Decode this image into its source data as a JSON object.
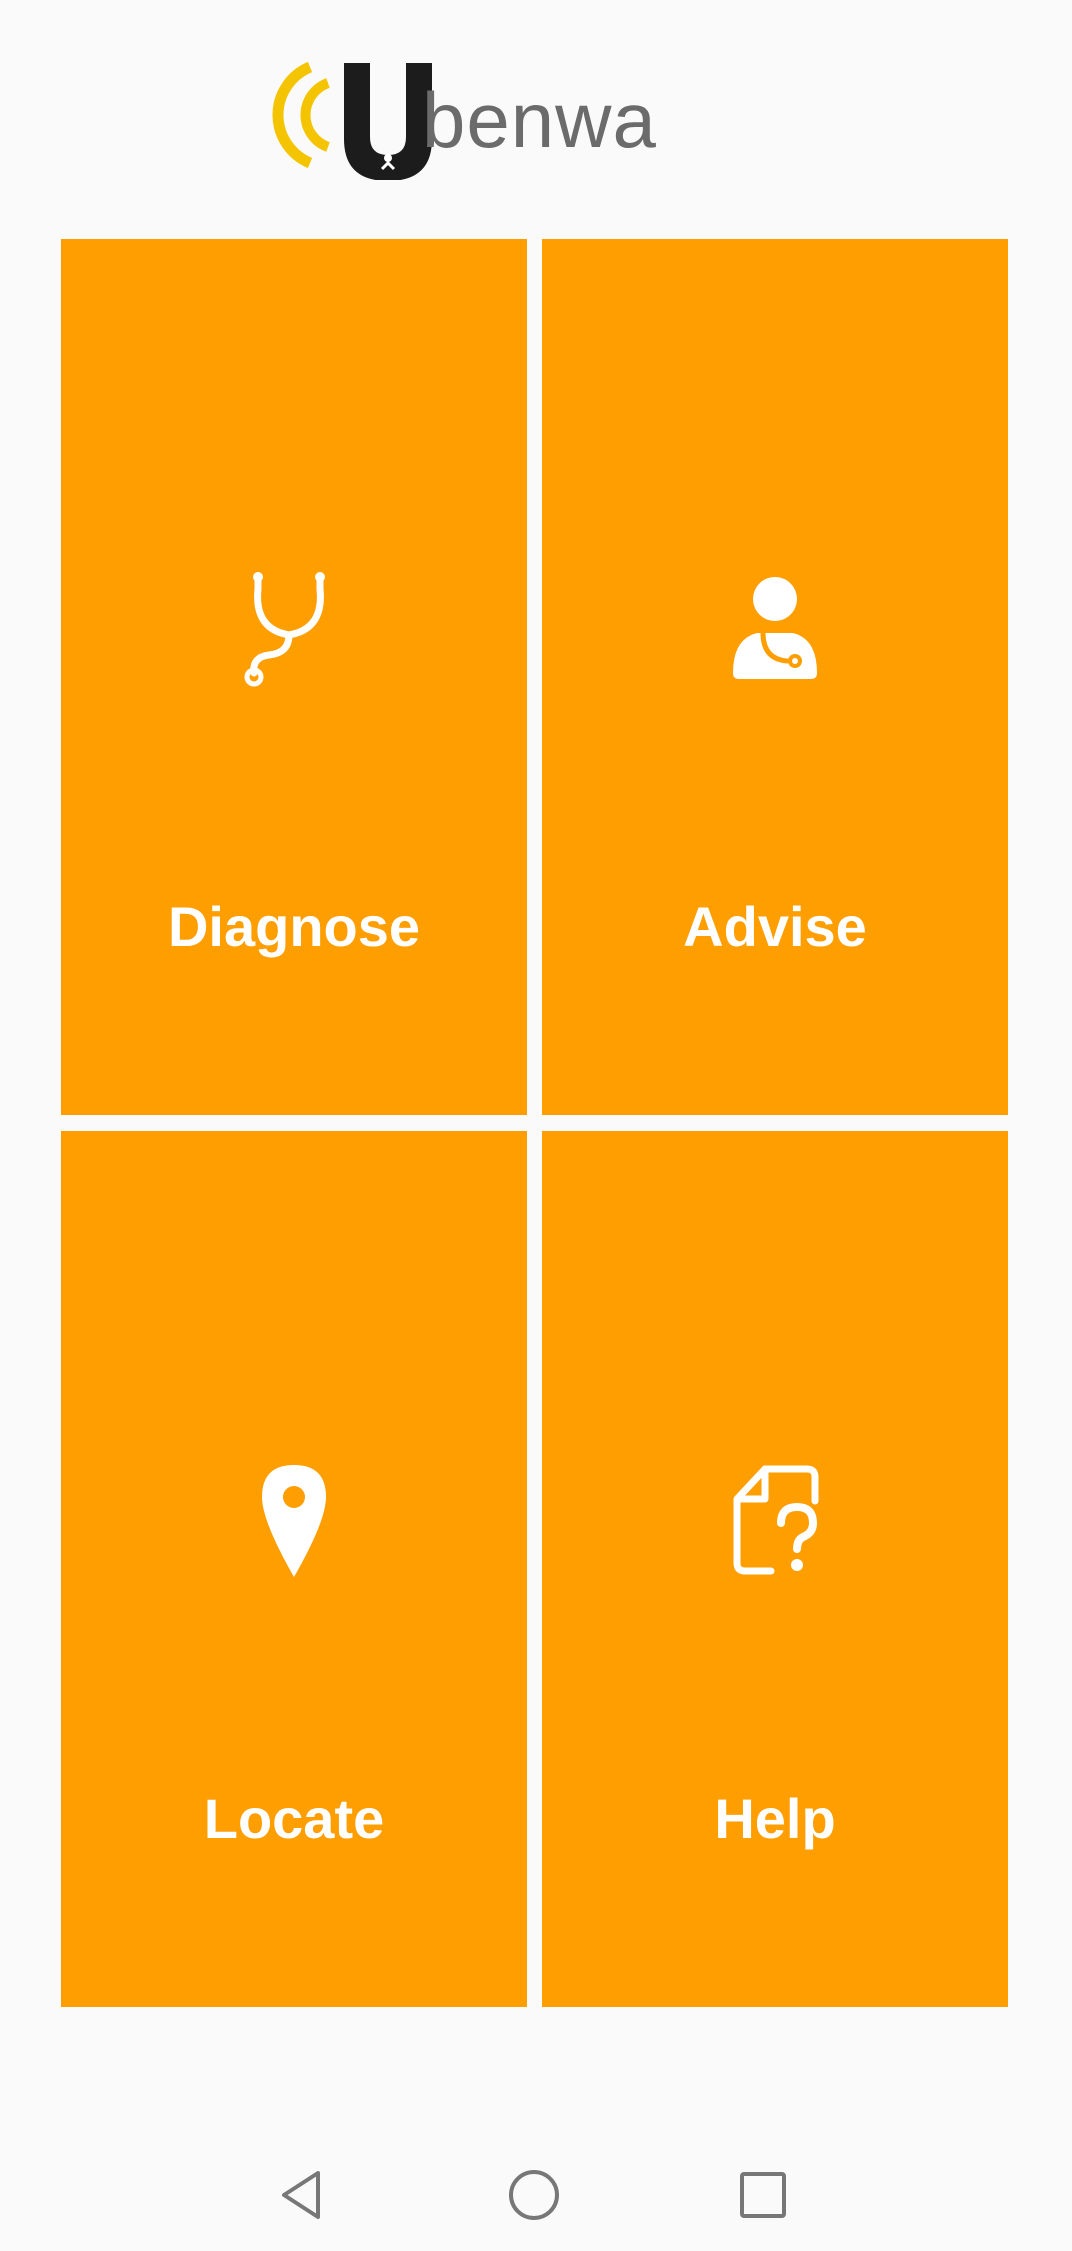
{
  "app": {
    "logo_letter": "U",
    "logo_text": "benwa",
    "brand_color": "#fe9e01",
    "logo_accent": "#f5c400"
  },
  "tiles": [
    {
      "label": "Diagnose",
      "icon": "stethoscope-icon"
    },
    {
      "label": "Advise",
      "icon": "doctor-icon"
    },
    {
      "label": "Locate",
      "icon": "location-pin-icon"
    },
    {
      "label": "Help",
      "icon": "help-document-icon"
    }
  ],
  "navbar": {
    "back": "back-icon",
    "home": "home-icon",
    "recents": "recents-icon"
  }
}
